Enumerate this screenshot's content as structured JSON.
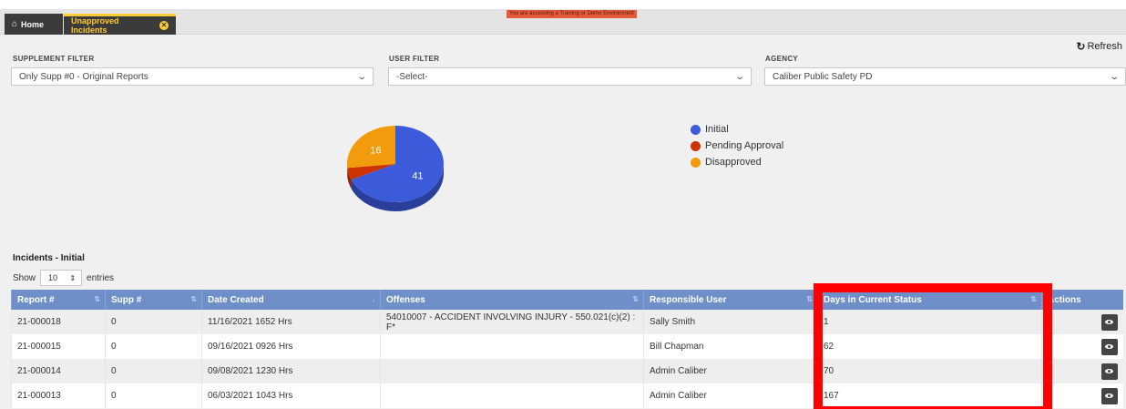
{
  "nav": {
    "home_label": "Home",
    "tab_label": "Unapproved Incidents",
    "demo_banner": "You are accessing a Training or Demo Environment"
  },
  "refresh_label": "Refresh",
  "filters": {
    "supplement": {
      "label": "Supplement Filter",
      "value": "Only Supp #0 - Original Reports"
    },
    "user": {
      "label": "User Filter",
      "value": "-Select-"
    },
    "agency": {
      "label": "Agency",
      "value": "Caliber Public Safety PD"
    }
  },
  "chart_data": {
    "type": "pie",
    "categories": [
      "Initial",
      "Pending Approval",
      "Disapproved"
    ],
    "values": [
      41,
      3,
      16
    ],
    "data_labels": [
      "41",
      "",
      "16"
    ],
    "colors": [
      "#3b5bdb",
      "#cc3300",
      "#f29b0c"
    ],
    "legend_position": "right"
  },
  "legend": [
    {
      "label": "Initial",
      "color": "#3b5bdb"
    },
    {
      "label": "Pending Approval",
      "color": "#cc3300"
    },
    {
      "label": "Disapproved",
      "color": "#f29b0c"
    }
  ],
  "section_title": "Incidents - Initial",
  "length_menu": {
    "prefix": "Show",
    "value": "10",
    "suffix": "entries"
  },
  "table": {
    "headers": [
      "Report #",
      "Supp #",
      "Date Created",
      "Offenses",
      "Responsible User",
      "Days in Current Status",
      "Actions"
    ],
    "rows": [
      [
        "21-000018",
        "0",
        "11/16/2021 1652 Hrs",
        "54010007 - ACCIDENT INVOLVING INJURY - 550.021(c)(2) : F*",
        "Sally Smith",
        "1"
      ],
      [
        "21-000015",
        "0",
        "09/16/2021 0926 Hrs",
        "",
        "Bill Chapman",
        "62"
      ],
      [
        "21-000014",
        "0",
        "09/08/2021 1230 Hrs",
        "",
        "Admin Caliber",
        "70"
      ],
      [
        "21-000013",
        "0",
        "06/03/2021 1043 Hrs",
        "",
        "Admin Caliber",
        "167"
      ]
    ]
  }
}
